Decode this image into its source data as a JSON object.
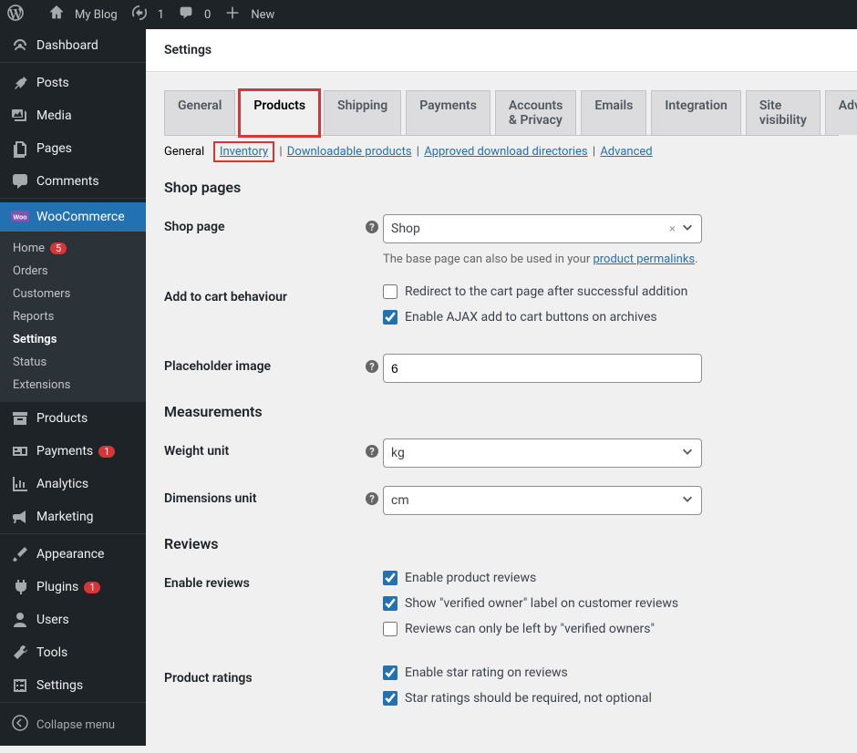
{
  "adminbar": {
    "site_name": "My Blog",
    "updates": "1",
    "comments": "0",
    "new": "New"
  },
  "sidebar": {
    "dashboard": "Dashboard",
    "posts": "Posts",
    "media": "Media",
    "pages": "Pages",
    "comments": "Comments",
    "woocommerce": "WooCommerce",
    "woo_sub": {
      "home": "Home",
      "home_badge": "5",
      "orders": "Orders",
      "customers": "Customers",
      "reports": "Reports",
      "settings": "Settings",
      "status": "Status",
      "extensions": "Extensions"
    },
    "products": "Products",
    "payments": "Payments",
    "payments_badge": "1",
    "analytics": "Analytics",
    "marketing": "Marketing",
    "appearance": "Appearance",
    "plugins": "Plugins",
    "plugins_badge": "1",
    "users": "Users",
    "tools": "Tools",
    "settings_menu": "Settings",
    "collapse": "Collapse menu"
  },
  "page": {
    "title": "Settings"
  },
  "tabs": {
    "general": "General",
    "products": "Products",
    "shipping": "Shipping",
    "payments": "Payments",
    "accounts": "Accounts & Privacy",
    "emails": "Emails",
    "integration": "Integration",
    "site_visibility": "Site visibility",
    "advanced": "Advanced"
  },
  "subtabs": {
    "general": "General",
    "inventory": "Inventory",
    "downloadable": "Downloadable products",
    "approved": "Approved download directories",
    "advanced": "Advanced"
  },
  "sections": {
    "shop_pages": "Shop pages",
    "measurements": "Measurements",
    "reviews": "Reviews"
  },
  "fields": {
    "shop_page_label": "Shop page",
    "shop_page_value": "Shop",
    "shop_page_desc_pre": "The base page can also be used in your ",
    "shop_page_desc_link": "product permalinks",
    "shop_page_desc_post": ".",
    "add_to_cart_label": "Add to cart behaviour",
    "cb_redirect": "Redirect to the cart page after successful addition",
    "cb_ajax": "Enable AJAX add to cart buttons on archives",
    "placeholder_label": "Placeholder image",
    "placeholder_value": "6",
    "weight_label": "Weight unit",
    "weight_value": "kg",
    "dim_label": "Dimensions unit",
    "dim_value": "cm",
    "enable_reviews_label": "Enable reviews",
    "cb_enable_reviews": "Enable product reviews",
    "cb_verified_label": "Show \"verified owner\" label on customer reviews",
    "cb_verified_only": "Reviews can only be left by \"verified owners\"",
    "ratings_label": "Product ratings",
    "cb_star_rating": "Enable star rating on reviews",
    "cb_star_required": "Star ratings should be required, not optional"
  }
}
